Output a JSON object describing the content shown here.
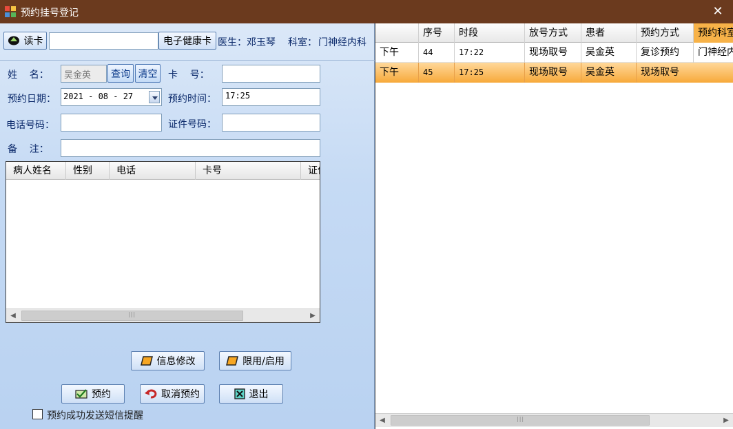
{
  "window": {
    "title": "预约挂号登记",
    "close_symbol": "✕"
  },
  "top": {
    "read_card_label": "读卡",
    "card_input_value": "",
    "health_card_label": "电子健康卡",
    "doctor_label": "医生：",
    "doctor_name": "邓玉琴",
    "dept_label": "科室：",
    "dept_name": "门神经内科"
  },
  "form": {
    "name_label": "姓    名：",
    "name_value": "吴金英",
    "query_label": "查询",
    "clear_label": "清空",
    "card_no_label": "卡    号：",
    "card_no_value": "",
    "date_label": "预约日期：",
    "date_value": "2021 - 08 - 27",
    "time_label": "预约时间：",
    "time_value": "17:25",
    "phone_label": "电话号码：",
    "phone_value": "",
    "id_label": "证件号码：",
    "id_value": "",
    "remark_label": "备    注：",
    "remark_value": ""
  },
  "patient_grid": {
    "columns": [
      "病人姓名",
      "性别",
      "电话",
      "卡号",
      "证件"
    ]
  },
  "buttons": {
    "edit_info": "信息修改",
    "toggle_limit": "限用/启用",
    "book": "预约",
    "cancel_booking": "取消预约",
    "exit": "退出"
  },
  "sms_checkbox": {
    "label": "预约成功发送短信提醒",
    "checked": false
  },
  "appointments": {
    "columns": [
      "",
      "序号",
      "时段",
      "放号方式",
      "患者",
      "预约方式",
      "预约科室"
    ],
    "rows": [
      {
        "period": "下午",
        "seq": "44",
        "time": "17:22",
        "release": "现场取号",
        "patient": "吴金英",
        "method": "复诊预约",
        "dept": "门神经内科",
        "selected": false
      },
      {
        "period": "下午",
        "seq": "45",
        "time": "17:25",
        "release": "现场取号",
        "patient": "吴金英",
        "method": "现场取号",
        "dept": "",
        "selected": true
      }
    ]
  },
  "colors": {
    "titlebar": "#6b3a1e",
    "selected_row": "#f7a93a",
    "panel": "#c5daf4"
  }
}
